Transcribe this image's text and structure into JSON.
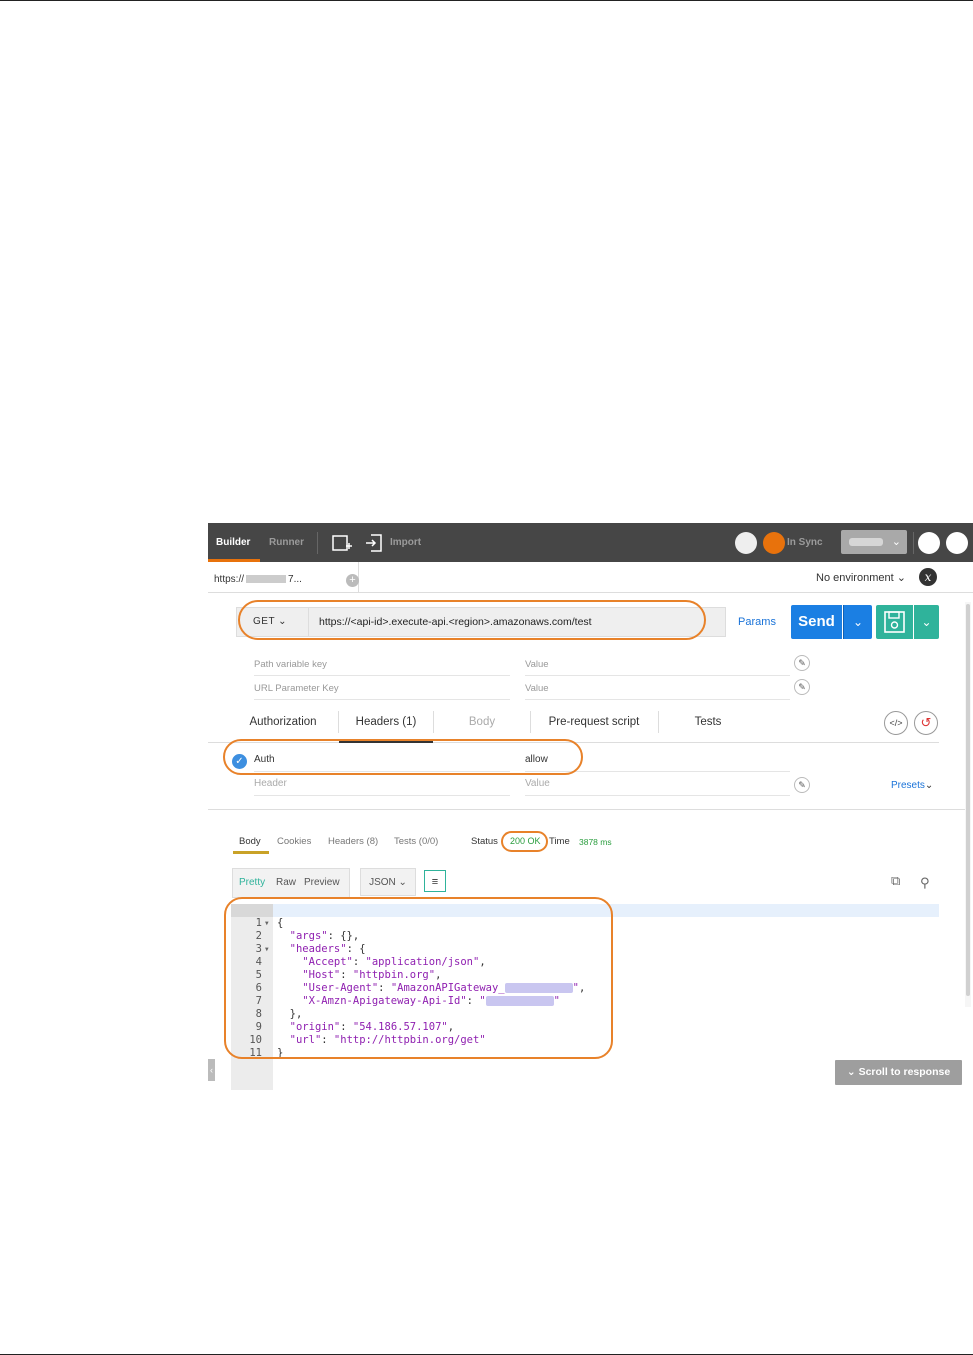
{
  "topbar": {
    "builder_label": "Builder",
    "runner_label": "Runner",
    "import_label": "Import",
    "sync_label": "In Sync"
  },
  "tabs": {
    "request_tab_prefix": "https://",
    "request_tab_suffix": "7...",
    "environment": "No environment"
  },
  "request": {
    "method": "GET",
    "url": "https://<api-id>.execute-api.<region>.amazonaws.com/test",
    "params_label": "Params",
    "send_label": "Send"
  },
  "url_params": {
    "path_key_placeholder": "Path variable key",
    "path_value_placeholder": "Value",
    "url_key_placeholder": "URL Parameter Key",
    "url_value_placeholder": "Value"
  },
  "request_tabs": [
    {
      "label": "Authorization"
    },
    {
      "label": "Headers (1)"
    },
    {
      "label": "Body"
    },
    {
      "label": "Pre-request script"
    },
    {
      "label": "Tests"
    }
  ],
  "headers": {
    "rows": [
      {
        "key": "Auth",
        "value": "allow"
      }
    ],
    "key_placeholder": "Header",
    "value_placeholder": "Value",
    "presets_label": "Presets"
  },
  "response": {
    "tabs": [
      {
        "label": "Body"
      },
      {
        "label": "Cookies"
      },
      {
        "label": "Headers (8)"
      },
      {
        "label": "Tests (0/0)"
      }
    ],
    "status_label": "Status",
    "status_value": "200 OK",
    "time_label": "Time",
    "time_value": "3878 ms",
    "view_modes": [
      "Pretty",
      "Raw",
      "Preview"
    ],
    "format": "JSON",
    "scroll_label": "Scroll to response"
  },
  "code_lines": [
    {
      "n": "1",
      "fold": true
    },
    {
      "n": "2",
      "fold": false
    },
    {
      "n": "3",
      "fold": true
    },
    {
      "n": "4",
      "fold": false
    },
    {
      "n": "5",
      "fold": false
    },
    {
      "n": "6",
      "fold": false
    },
    {
      "n": "7",
      "fold": false
    },
    {
      "n": "8",
      "fold": false
    },
    {
      "n": "9",
      "fold": false
    },
    {
      "n": "10",
      "fold": false
    },
    {
      "n": "11",
      "fold": false
    }
  ],
  "json_body": {
    "args_key": "\"args\"",
    "headers_key": "\"headers\"",
    "accept_key": "\"Accept\"",
    "accept_value": "\"application/json\"",
    "host_key": "\"Host\"",
    "host_value": "\"httpbin.org\"",
    "ua_key": "\"User-Agent\"",
    "ua_value_prefix": "\"AmazonAPIGateway_",
    "apiid_key": "\"X-Amzn-Apigateway-Api-Id\"",
    "origin_key": "\"origin\"",
    "origin_value": "\"54.186.57.107\"",
    "url_key": "\"url\"",
    "url_value": "\"http://httpbin.org/get\""
  },
  "colors": {
    "topbar": "#464646",
    "accent_orange": "#e8720c",
    "send_blue": "#1b7fe3",
    "save_teal": "#2fb39b",
    "status_green": "#2a9d3e",
    "annotation": "#e8822a",
    "json_string": "#8f1fb0"
  }
}
